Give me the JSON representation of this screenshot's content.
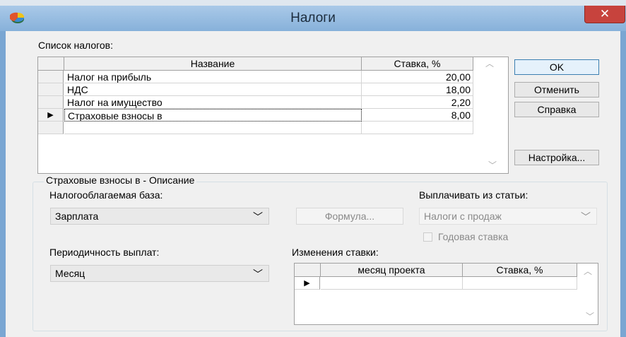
{
  "window": {
    "title": "Налоги",
    "close_glyph": "✕",
    "app_icon": "pie-chart-icon"
  },
  "taxes_label": "Список налогов:",
  "taxes_table": {
    "columns": [
      "Название",
      "Ставка, %"
    ],
    "rows": [
      {
        "name": "Налог на прибыль",
        "rate": "20,00",
        "current": false
      },
      {
        "name": "НДС",
        "rate": "18,00",
        "current": false
      },
      {
        "name": "Налог на имущество",
        "rate": "2,20",
        "current": false
      },
      {
        "name": "Страховые взносы в",
        "rate": "8,00",
        "current": true
      },
      {
        "name": "",
        "rate": "",
        "current": false
      }
    ],
    "row_pointer": "▶",
    "scroll_up_glyph": "︿",
    "scroll_down_glyph": "﹀"
  },
  "buttons": {
    "ok": "OK",
    "cancel": "Отменить",
    "help": "Справка",
    "settings": "Настройка..."
  },
  "description": {
    "group_title": "Страховые взносы в  - Описание",
    "tax_base_label": "Налогооблагаемая база:",
    "tax_base_value": "Зарплата",
    "formula_button": "Формула...",
    "pay_from_label": "Выплачивать из статьи:",
    "pay_from_value": "Налоги с продаж",
    "annual_rate_label": "Годовая ставка",
    "annual_rate_checked": false,
    "periodicity_label": "Периодичность выплат:",
    "periodicity_value": "Месяц",
    "combo_arrow_glyph": "﹀",
    "rate_changes_label": "Изменения ставки:",
    "rate_changes_table": {
      "columns": [
        "месяц проекта",
        "Ставка, %"
      ],
      "rows": [
        {
          "month": "",
          "rate": "",
          "current": true
        }
      ]
    }
  }
}
